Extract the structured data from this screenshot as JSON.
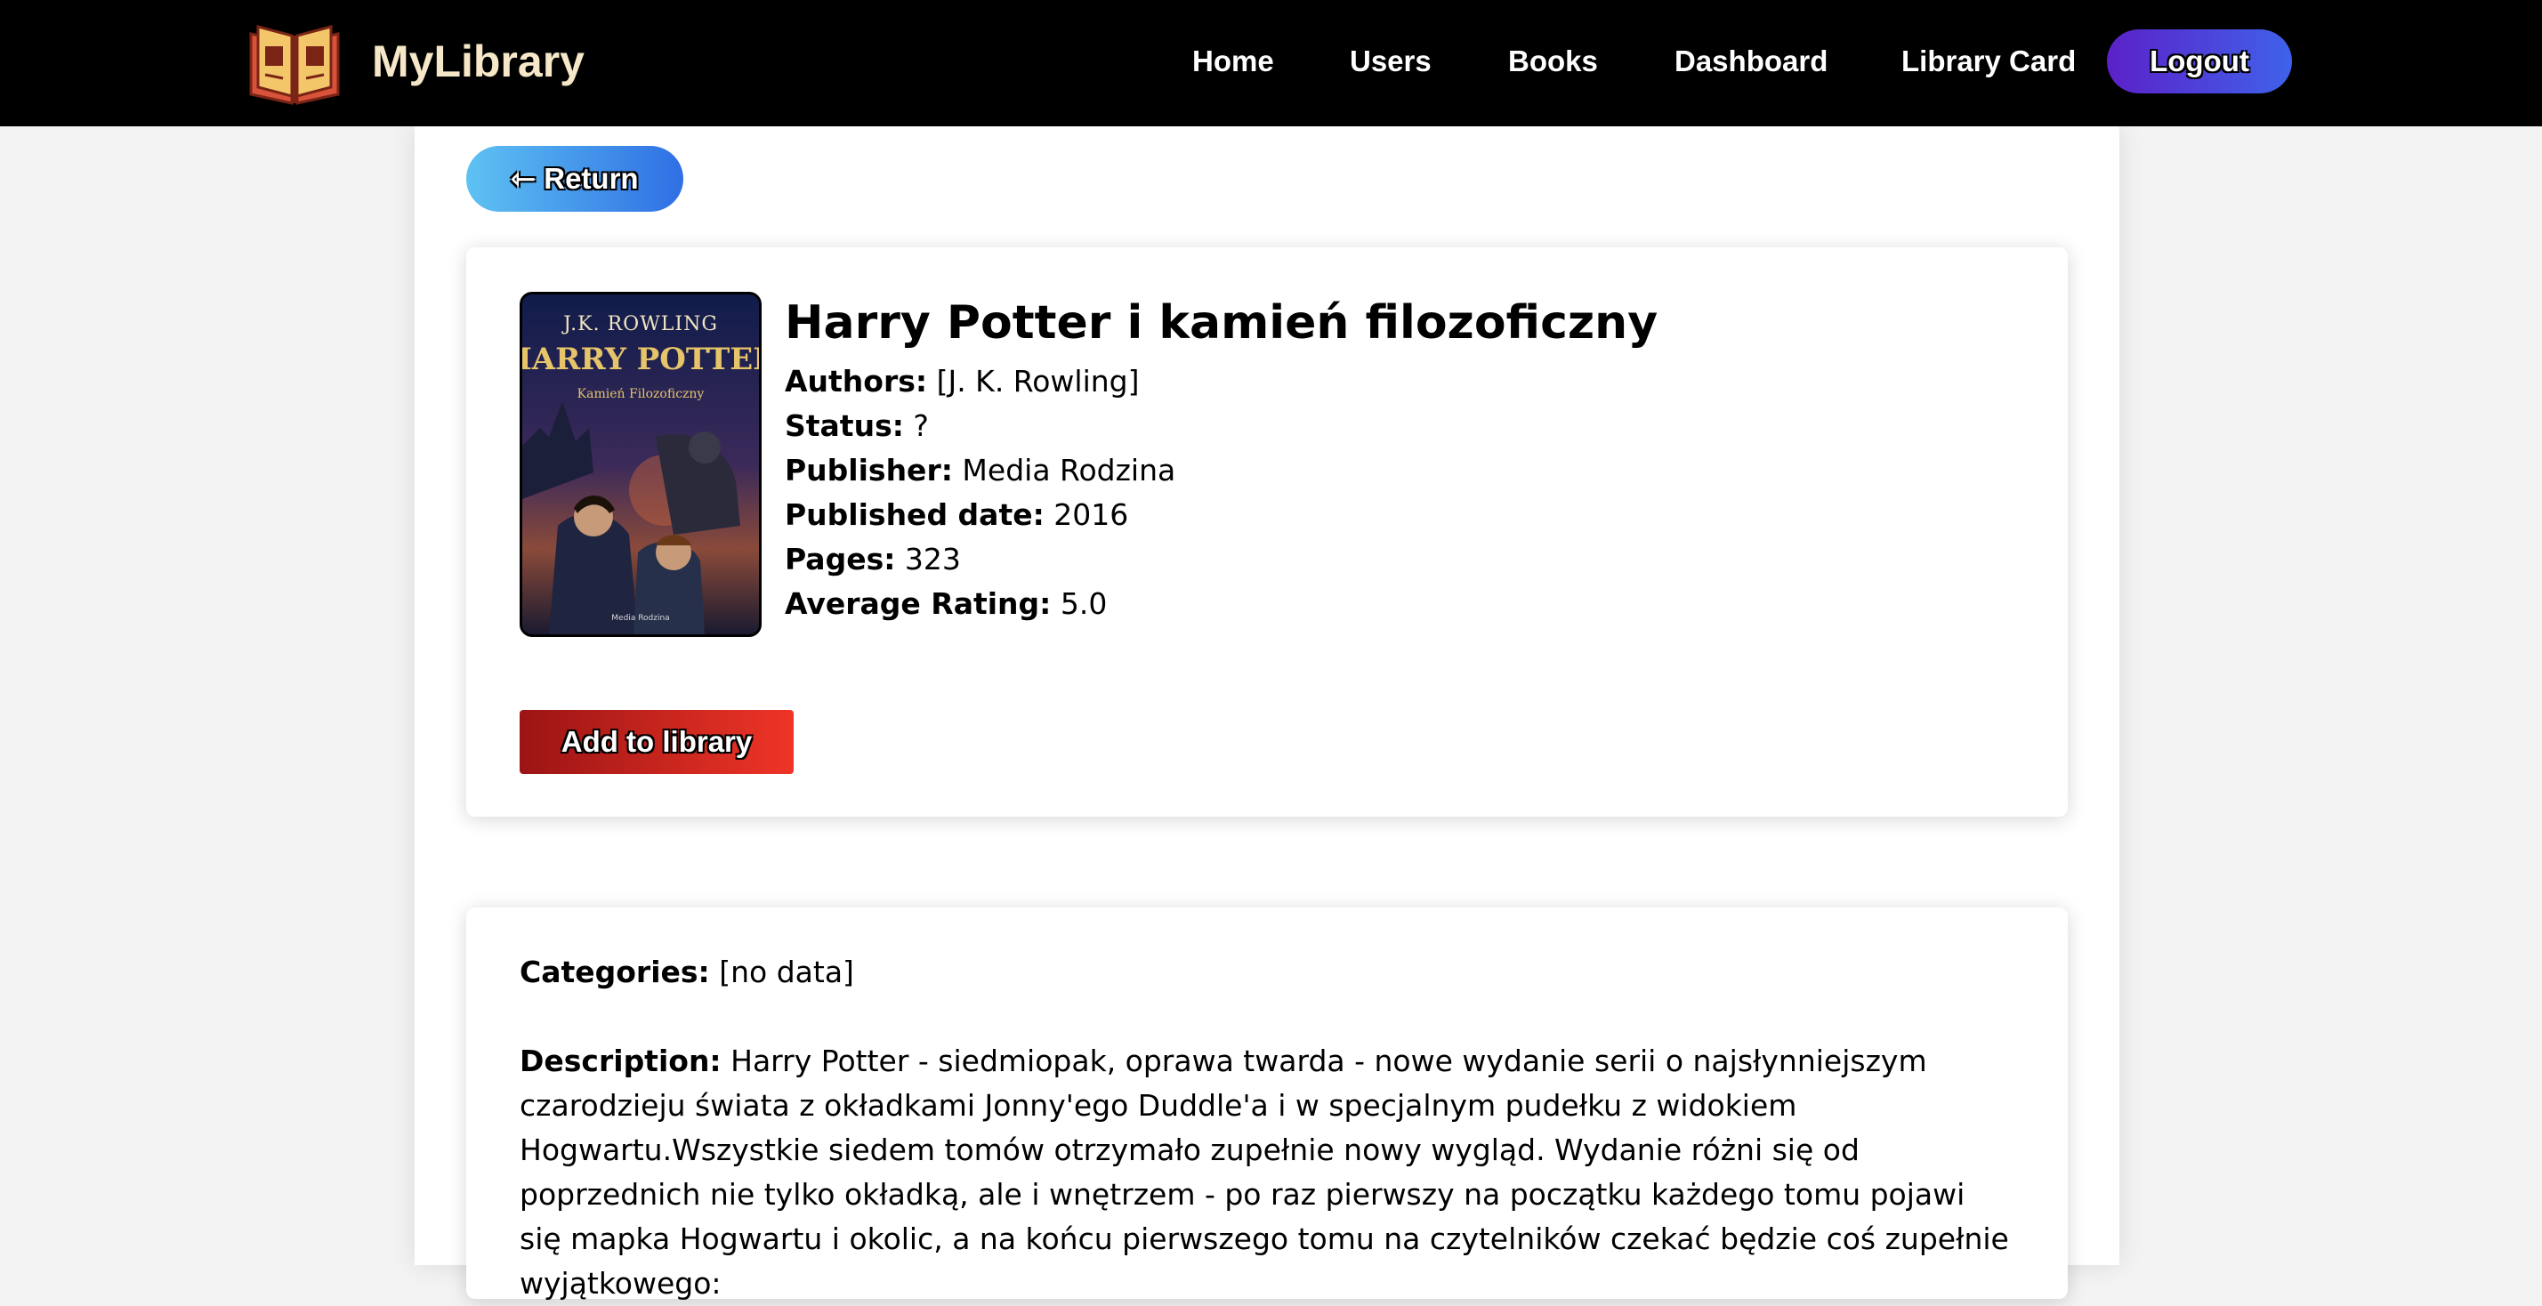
{
  "navbar": {
    "brand": "MyLibrary",
    "links": [
      {
        "label": "Home"
      },
      {
        "label": "Users"
      },
      {
        "label": "Books"
      },
      {
        "label": "Dashboard"
      },
      {
        "label": "Library Card"
      }
    ],
    "logout_label": "Logout"
  },
  "return_label": "⇽ Return",
  "book": {
    "cover_texts": {
      "author": "J.K. ROWLING",
      "series": "HARRY POTTER",
      "subtitle": "Kamień Filozoficzny",
      "publisher": "Media Rodzina"
    },
    "title": "Harry Potter i kamień filozoficzny",
    "authors_label": "Authors:",
    "authors_value": "[J. K. Rowling]",
    "status_label": "Status:",
    "status_value": "?",
    "publisher_label": "Publisher:",
    "publisher_value": "Media Rodzina",
    "published_label": "Published date:",
    "published_value": "2016",
    "pages_label": "Pages:",
    "pages_value": "323",
    "rating_label": "Average Rating:",
    "rating_value": "5.0",
    "add_label": "Add to library"
  },
  "details": {
    "categories_label": "Categories:",
    "categories_value": "[no data]",
    "description_label": "Description:",
    "description_text": "Harry Potter - siedmiopak, oprawa twarda - nowe wydanie serii o najsłynniejszym czarodzieju świata z okładkami Jonny'ego Duddle'a i w specjalnym pudełku z widokiem Hogwartu.Wszystkie siedem tomów otrzymało zupełnie nowy wygląd. Wydanie różni się od poprzednich nie tylko okładką, ale i wnętrzem - po raz pierwszy na początku każdego tomu pojawi się mapka Hogwartu i okolic, a na końcu pierwszego tomu na czytelników czekać będzie coś zupełnie wyjątkowego:"
  },
  "colors": {
    "navbar_bg": "#000000",
    "brand_color": "#f6e7c8",
    "logout_gradient": [
      "#5b21c8",
      "#3f62ea"
    ],
    "return_gradient": [
      "#5ec2f2",
      "#2f6fe4"
    ],
    "add_gradient": [
      "#9b1414",
      "#ef3527"
    ],
    "page_bg": "#f3f3f3"
  },
  "icons": {
    "logo": "open-book-icon"
  }
}
